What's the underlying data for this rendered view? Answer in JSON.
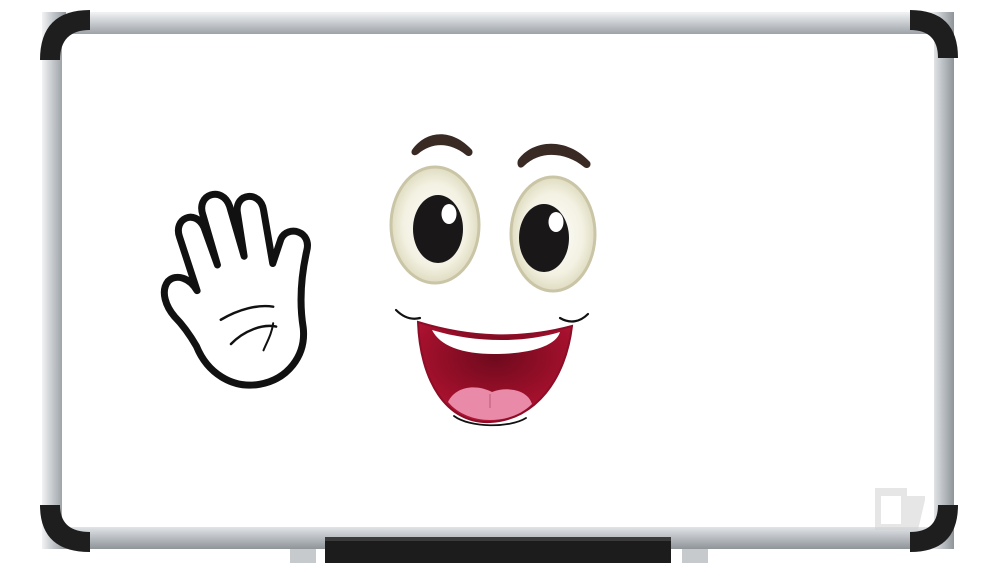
{
  "scene": {
    "subject": "whiteboard-with-cartoon-face-and-waving-hand",
    "colors": {
      "background": "#ffffff",
      "board_surface": "#ffffff",
      "frame_light": "#e6e8ea",
      "frame_mid": "#b9bdc1",
      "frame_dark": "#8e9398",
      "corner": "#1e1e1e",
      "tray": "#1c1c1c",
      "outline": "#111111",
      "eye_white": "#f3f1e2",
      "eye_rim": "#c9c5a6",
      "pupil": "#1a1718",
      "brow": "#3a2a24",
      "mouth": "#a3102c",
      "mouth_inner": "#6e0a1d",
      "teeth": "#ffffff",
      "tongue": "#e88aa8",
      "watermark": "#d2d2d2"
    },
    "icons": {
      "hand": "waving-hand-icon",
      "logo": "channel-logo-icon"
    }
  }
}
